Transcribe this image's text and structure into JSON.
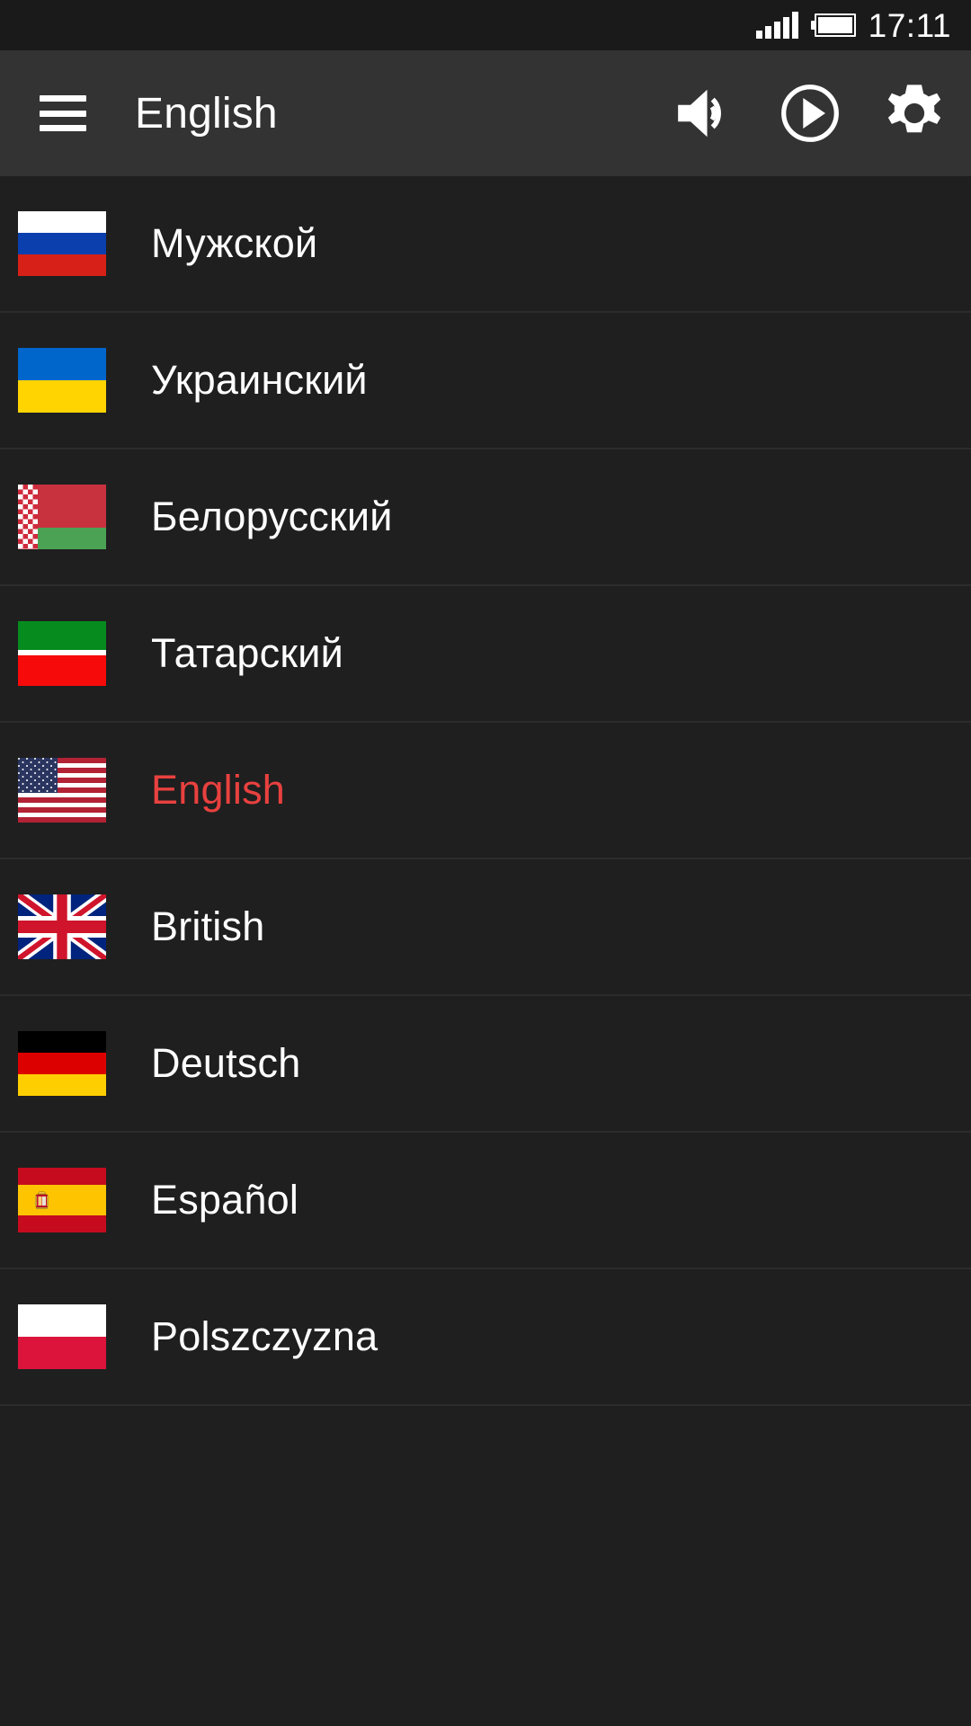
{
  "statusbar": {
    "time": "17:11",
    "signal_icon": "signal-bars-icon",
    "battery_icon": "battery-icon"
  },
  "toolbar": {
    "menu_icon": "hamburger-menu-icon",
    "title": "English",
    "actions": [
      {
        "name": "speaker-icon",
        "label": "Sound"
      },
      {
        "name": "play-circle-icon",
        "label": "Play"
      },
      {
        "name": "gear-icon",
        "label": "Settings"
      }
    ]
  },
  "colors": {
    "statusbar_bg": "#1a1a1a",
    "toolbar_bg": "#333333",
    "list_bg": "#1f1f1f",
    "divider": "#2c2c2c",
    "text": "#ffffff",
    "selected_text": "#e8413f"
  },
  "list": {
    "items": [
      {
        "label": "Мужской",
        "flag": "russia-flag",
        "flag_class": "f-ru",
        "selected": false
      },
      {
        "label": "Украинский",
        "flag": "ukraine-flag",
        "flag_class": "f-ua",
        "selected": false
      },
      {
        "label": "Белорусский",
        "flag": "belarus-flag",
        "flag_class": "f-by",
        "selected": false
      },
      {
        "label": "Татарский",
        "flag": "tatarstan-flag",
        "flag_class": "f-tt",
        "selected": false
      },
      {
        "label": "English",
        "flag": "usa-flag",
        "flag_class": "f-us",
        "selected": true
      },
      {
        "label": "British",
        "flag": "united-kingdom-flag",
        "flag_class": "f-gb",
        "selected": false
      },
      {
        "label": "Deutsch",
        "flag": "germany-flag",
        "flag_class": "f-de",
        "selected": false
      },
      {
        "label": "Español",
        "flag": "spain-flag",
        "flag_class": "f-es",
        "selected": false
      },
      {
        "label": "Polszczyzna",
        "flag": "poland-flag",
        "flag_class": "f-pl",
        "selected": false
      }
    ]
  }
}
